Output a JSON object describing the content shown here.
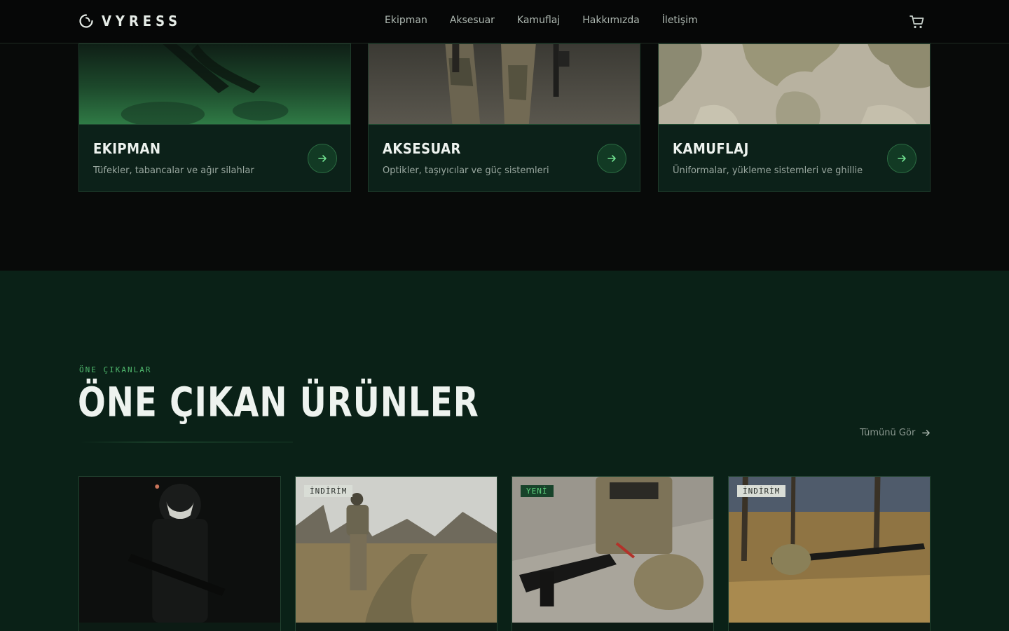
{
  "brand": {
    "name": "VYRESS",
    "logo_icon": "ring-logo-icon"
  },
  "nav": {
    "links": [
      "Ekipman",
      "Aksesuar",
      "Kamuflaj",
      "Hakkımızda",
      "İletişim"
    ],
    "cart_icon": "cart-icon"
  },
  "categories": [
    {
      "title": "EKIPMAN",
      "desc": "Tüfekler, tabancalar ve ağır silahlar",
      "icon": "arrow-right-icon"
    },
    {
      "title": "AKSESUAR",
      "desc": "Optikler, taşıyıcılar ve güç sistemleri",
      "icon": "arrow-right-icon"
    },
    {
      "title": "KAMUFLAJ",
      "desc": "Üniformalar, yükleme sistemleri ve ghillie",
      "icon": "arrow-right-icon"
    }
  ],
  "featured": {
    "eyebrow": "ÖNE ÇIKANLAR",
    "title": "ÖNE ÇIKAN ÜRÜNLER",
    "view_all": "Tümünü Gör",
    "products": [
      {
        "badge": ""
      },
      {
        "badge": "İNDİRİM"
      },
      {
        "badge": "YENİ"
      },
      {
        "badge": "İNDİRİM"
      }
    ]
  },
  "colors": {
    "accent": "#4fb86d",
    "section_dark": "#080a09",
    "section_green": "#0a2117",
    "badge_new": "#17432a",
    "badge_sale": "#d9ddd6"
  }
}
